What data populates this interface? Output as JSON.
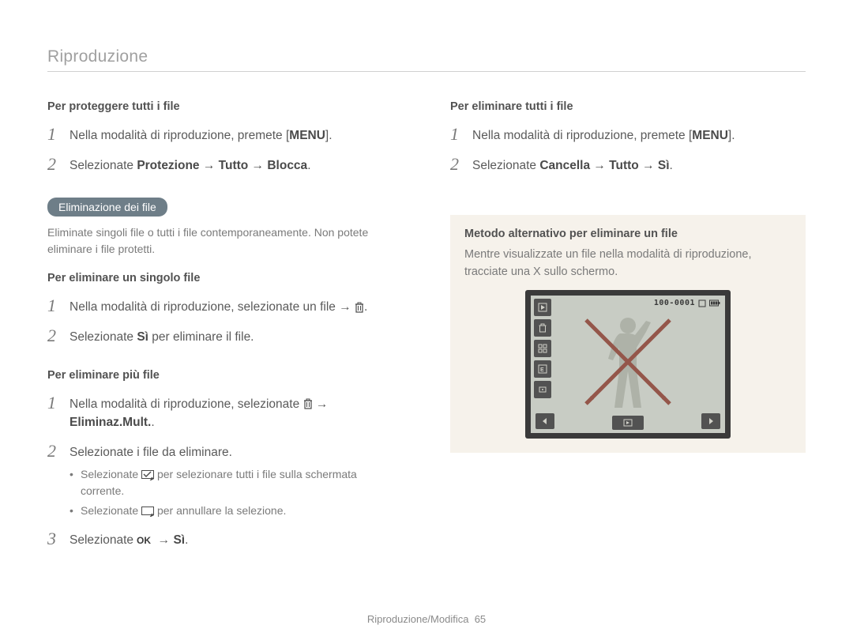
{
  "header": "Riproduzione",
  "left": {
    "protect": {
      "title": "Per proteggere tutti i file",
      "step1_a": "Nella modalità di riproduzione, premete [",
      "step1_b": "MENU",
      "step1_c": "].",
      "step2_a": "Selezionate ",
      "step2_b": "Protezione → Tutto → Blocca",
      "step2_c": "."
    },
    "delete_section": {
      "pill": "Eliminazione dei file",
      "descr": "Eliminate singoli file o tutti i file contemporaneamente. Non potete eliminare i file protetti."
    },
    "del_single": {
      "title": "Per eliminare un singolo file",
      "step1": "Nella modalità di riproduzione, selezionate un file → ",
      "step2_a": "Selezionate ",
      "step2_b": "Sì",
      "step2_c": " per eliminare il file."
    },
    "del_multi": {
      "title": "Per eliminare più file",
      "step1_a": "Nella modalità di riproduzione, selezionate ",
      "step1_b": " → ",
      "step1_c": "Eliminaz.Mult.",
      "step1_d": ".",
      "step2": "Selezionate i file da eliminare.",
      "bullet1_a": "Selezionate ",
      "bullet1_b": " per selezionare tutti i file sulla schermata corrente.",
      "bullet2_a": "Selezionate ",
      "bullet2_b": " per annullare la selezione.",
      "step3_a": "Selezionate ",
      "step3_b": " → ",
      "step3_c": "Sì",
      "step3_d": "."
    }
  },
  "right": {
    "del_all": {
      "title": "Per eliminare tutti i file",
      "step1_a": "Nella modalità di riproduzione, premete [",
      "step1_b": "MENU",
      "step1_c": "].",
      "step2_a": "Selezionate ",
      "step2_b": "Cancella → Tutto → Sì",
      "step2_c": "."
    },
    "alt": {
      "title": "Metodo alternativo per eliminare un file",
      "text": "Mentre visualizzate un file nella modalità di riproduzione, tracciate una X sullo schermo."
    },
    "screen": {
      "filenum": "100-0001"
    }
  },
  "footer_a": "Riproduzione/Modifica",
  "footer_b": "65",
  "nums": {
    "n1": "1",
    "n2": "2",
    "n3": "3"
  }
}
